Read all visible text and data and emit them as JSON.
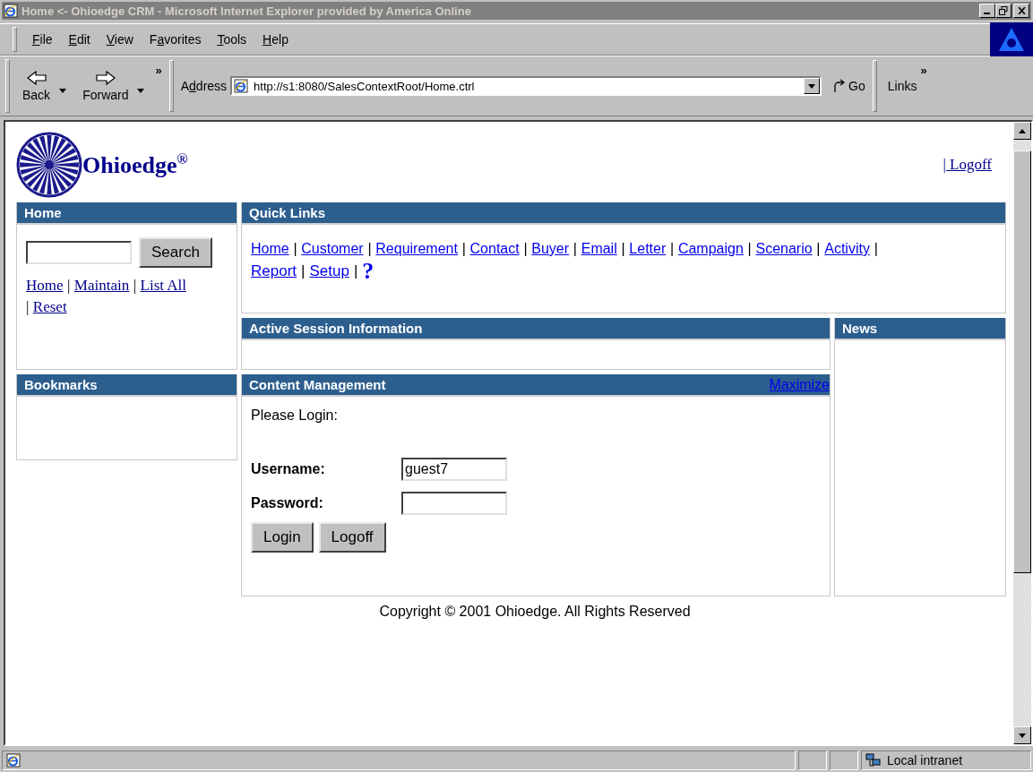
{
  "window": {
    "title": "Home <- Ohioedge CRM - Microsoft Internet Explorer provided by America Online"
  },
  "menu": [
    {
      "key": "F",
      "rest": "ile"
    },
    {
      "key": "E",
      "rest": "dit"
    },
    {
      "key": "V",
      "rest": "iew"
    },
    {
      "pre": "F",
      "key": "a",
      "rest": "vorites"
    },
    {
      "key": "T",
      "rest": "ools"
    },
    {
      "key": "H",
      "rest": "elp"
    }
  ],
  "toolbar": {
    "back": "Back",
    "forward": "Forward",
    "more": "»",
    "address_label": {
      "pre": "A",
      "key": "d",
      "rest": "dress"
    },
    "url": "http://s1:8080/SalesContextRoot/Home.ctrl",
    "go": "Go",
    "links": "Links",
    "links_more": "»"
  },
  "page": {
    "logo": "Ohioedge$^{®}$",
    "logoff": "| Logoff",
    "separator": "|",
    "home_panel": {
      "title": "Home",
      "search_button": "Search",
      "links": [
        "Home",
        "Maintain",
        "List All",
        "Reset"
      ]
    },
    "bookmarks_panel": {
      "title": "Bookmarks"
    },
    "quick_links_panel": {
      "title": "Quick Links",
      "links": [
        "Home",
        "Customer",
        "Requirement",
        "Contact",
        "Buyer",
        "Email",
        "Letter",
        "Campaign",
        "Scenario",
        "Activity",
        "Report",
        "Setup"
      ],
      "help": "?"
    },
    "session_panel": {
      "title": "Active Session Information"
    },
    "news_panel": {
      "title": "News"
    },
    "content_panel": {
      "title": "Content Management",
      "maximize": "Maximize",
      "prompt": "Please Login:",
      "username_label": "Username:",
      "username": "guest7",
      "password_label": "Password:",
      "buttons": [
        "Login",
        "Logoff"
      ]
    },
    "copyright": "Copyright © 2001 Ohioedge. All Rights Reserved"
  },
  "status_bar": {
    "zone": "Local intranet"
  }
}
